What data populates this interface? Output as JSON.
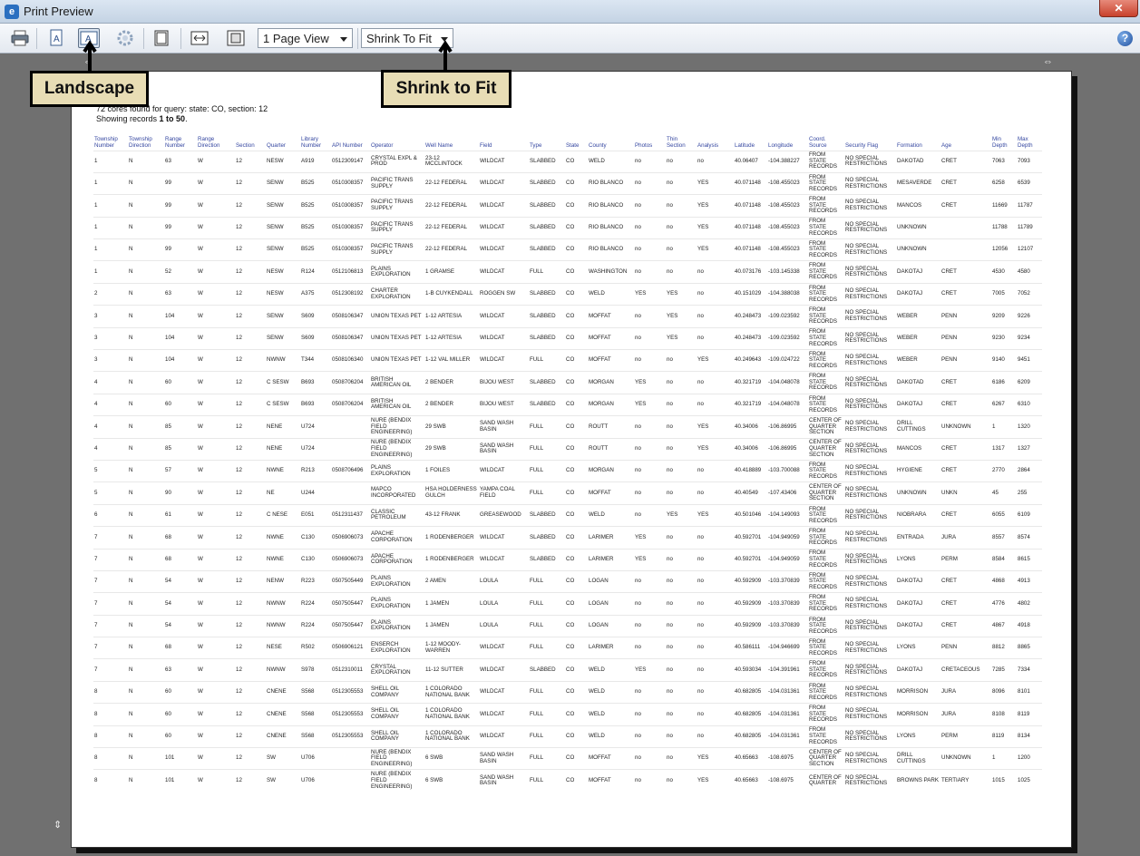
{
  "window": {
    "title": "Print Preview"
  },
  "toolbar": {
    "page_view": "1 Page View",
    "shrink": "Shrink To Fit",
    "print_icon": "printer-icon",
    "portrait_icon": "portrait-icon",
    "landscape_icon": "landscape-icon",
    "page_setup_icon": "gear-icon",
    "header_footer_icon": "header-footer-icon",
    "full_width_icon": "full-width-icon",
    "full_page_icon": "full-page-icon",
    "help_icon": "help-icon"
  },
  "callouts": {
    "landscape": "Landscape",
    "shrink": "Shrink to Fit"
  },
  "report": {
    "line1": "72 cores found for query: state: CO, section: 12",
    "line2_prefix": "Showing records ",
    "line2_range": "1 to 50",
    "line2_suffix": "."
  },
  "table": {
    "columns": [
      "Township Number",
      "Township Direction",
      "Range Number",
      "Range Direction",
      "Section",
      "Quarter",
      "Library Number",
      "API Number",
      "Operator",
      "Well Name",
      "Field",
      "Type",
      "State",
      "County",
      "Photos",
      "Thin Section",
      "Analysis",
      "Latitude",
      "Longitude",
      "Coord. Source",
      "Security Flag",
      "Formation",
      "Age",
      "Min Depth",
      "Max Depth"
    ],
    "rows": [
      [
        "1",
        "N",
        "63",
        "W",
        "12",
        "NESW",
        "A919",
        "0512309147",
        "CRYSTAL EXPL & PROD",
        "23-12 MCCLINTOCK",
        "WILDCAT",
        "SLABBED",
        "CO",
        "WELD",
        "no",
        "no",
        "no",
        "40.06407",
        "-104.388227",
        "FROM STATE RECORDS",
        "NO SPECIAL RESTRICTIONS",
        "DAKOTAD",
        "CRET",
        "7063",
        "7093"
      ],
      [
        "1",
        "N",
        "99",
        "W",
        "12",
        "SENW",
        "B525",
        "0510308357",
        "PACIFIC TRANS SUPPLY",
        "22-12 FEDERAL",
        "WILDCAT",
        "SLABBED",
        "CO",
        "RIO BLANCO",
        "no",
        "no",
        "YES",
        "40.071148",
        "-108.455023",
        "FROM STATE RECORDS",
        "NO SPECIAL RESTRICTIONS",
        "MESAVERDE",
        "CRET",
        "6258",
        "6539"
      ],
      [
        "1",
        "N",
        "99",
        "W",
        "12",
        "SENW",
        "B525",
        "0510308357",
        "PACIFIC TRANS SUPPLY",
        "22-12 FEDERAL",
        "WILDCAT",
        "SLABBED",
        "CO",
        "RIO BLANCO",
        "no",
        "no",
        "YES",
        "40.071148",
        "-108.455023",
        "FROM STATE RECORDS",
        "NO SPECIAL RESTRICTIONS",
        "MANCOS",
        "CRET",
        "11669",
        "11787"
      ],
      [
        "1",
        "N",
        "99",
        "W",
        "12",
        "SENW",
        "B525",
        "0510308357",
        "PACIFIC TRANS SUPPLY",
        "22-12 FEDERAL",
        "WILDCAT",
        "SLABBED",
        "CO",
        "RIO BLANCO",
        "no",
        "no",
        "YES",
        "40.071148",
        "-108.455023",
        "FROM STATE RECORDS",
        "NO SPECIAL RESTRICTIONS",
        "UNKNOWN",
        "",
        "11788",
        "11789"
      ],
      [
        "1",
        "N",
        "99",
        "W",
        "12",
        "SENW",
        "B525",
        "0510308357",
        "PACIFIC TRANS SUPPLY",
        "22-12 FEDERAL",
        "WILDCAT",
        "SLABBED",
        "CO",
        "RIO BLANCO",
        "no",
        "no",
        "YES",
        "40.071148",
        "-108.455023",
        "FROM STATE RECORDS",
        "NO SPECIAL RESTRICTIONS",
        "UNKNOWN",
        "",
        "12056",
        "12107"
      ],
      [
        "1",
        "N",
        "52",
        "W",
        "12",
        "NESW",
        "R124",
        "0512106813",
        "PLAINS EXPLORATION",
        "1 GRAMSE",
        "WILDCAT",
        "FULL",
        "CO",
        "WASHINGTON",
        "no",
        "no",
        "no",
        "40.073176",
        "-103.145338",
        "FROM STATE RECORDS",
        "NO SPECIAL RESTRICTIONS",
        "DAKOTAJ",
        "CRET",
        "4530",
        "4580"
      ],
      [
        "2",
        "N",
        "63",
        "W",
        "12",
        "NESW",
        "A375",
        "0512308192",
        "CHARTER EXPLORATION",
        "1-B CUYKENDALL",
        "ROGGEN SW",
        "SLABBED",
        "CO",
        "WELD",
        "YES",
        "YES",
        "no",
        "40.151029",
        "-104.388038",
        "FROM STATE RECORDS",
        "NO SPECIAL RESTRICTIONS",
        "DAKOTAJ",
        "CRET",
        "7005",
        "7052"
      ],
      [
        "3",
        "N",
        "104",
        "W",
        "12",
        "SENW",
        "S609",
        "0508106347",
        "UNION TEXAS PET",
        "1-12 ARTESIA",
        "WILDCAT",
        "SLABBED",
        "CO",
        "MOFFAT",
        "no",
        "YES",
        "no",
        "40.248473",
        "-109.023592",
        "FROM STATE RECORDS",
        "NO SPECIAL RESTRICTIONS",
        "WEBER",
        "PENN",
        "9209",
        "9226"
      ],
      [
        "3",
        "N",
        "104",
        "W",
        "12",
        "SENW",
        "S609",
        "0508106347",
        "UNION TEXAS PET",
        "1-12 ARTESIA",
        "WILDCAT",
        "SLABBED",
        "CO",
        "MOFFAT",
        "no",
        "YES",
        "no",
        "40.248473",
        "-109.023592",
        "FROM STATE RECORDS",
        "NO SPECIAL RESTRICTIONS",
        "WEBER",
        "PENN",
        "9230",
        "9234"
      ],
      [
        "3",
        "N",
        "104",
        "W",
        "12",
        "NWNW",
        "T344",
        "0508106340",
        "UNION TEXAS PET",
        "1-12 VAL MILLER",
        "WILDCAT",
        "FULL",
        "CO",
        "MOFFAT",
        "no",
        "no",
        "YES",
        "40.249643",
        "-109.024722",
        "FROM STATE RECORDS",
        "NO SPECIAL RESTRICTIONS",
        "WEBER",
        "PENN",
        "9140",
        "9451"
      ],
      [
        "4",
        "N",
        "60",
        "W",
        "12",
        "C SESW",
        "B693",
        "0508706204",
        "BRITISH AMERICAN OIL",
        "2 BENDER",
        "BIJOU WEST",
        "SLABBED",
        "CO",
        "MORGAN",
        "YES",
        "no",
        "no",
        "40.321719",
        "-104.048078",
        "FROM STATE RECORDS",
        "NO SPECIAL RESTRICTIONS",
        "DAKOTAD",
        "CRET",
        "6186",
        "6209"
      ],
      [
        "4",
        "N",
        "60",
        "W",
        "12",
        "C SESW",
        "B693",
        "0508706204",
        "BRITISH AMERICAN OIL",
        "2 BENDER",
        "BIJOU WEST",
        "SLABBED",
        "CO",
        "MORGAN",
        "YES",
        "no",
        "no",
        "40.321719",
        "-104.048078",
        "FROM STATE RECORDS",
        "NO SPECIAL RESTRICTIONS",
        "DAKOTAJ",
        "CRET",
        "6267",
        "6310"
      ],
      [
        "4",
        "N",
        "85",
        "W",
        "12",
        "NENE",
        "U724",
        "",
        "NURE (BENDIX FIELD ENGINEERING)",
        "29 SWB",
        "SAND WASH BASIN",
        "FULL",
        "CO",
        "ROUTT",
        "no",
        "no",
        "YES",
        "40.34006",
        "-106.86995",
        "CENTER OF QUARTER SECTION",
        "NO SPECIAL RESTRICTIONS",
        "DRILL CUTTINGS",
        "UNKNOWN",
        "1",
        "1320"
      ],
      [
        "4",
        "N",
        "85",
        "W",
        "12",
        "NENE",
        "U724",
        "",
        "NURE (BENDIX FIELD ENGINEERING)",
        "29 SWB",
        "SAND WASH BASIN",
        "FULL",
        "CO",
        "ROUTT",
        "no",
        "no",
        "YES",
        "40.34006",
        "-106.86995",
        "CENTER OF QUARTER SECTION",
        "NO SPECIAL RESTRICTIONS",
        "MANCOS",
        "CRET",
        "1317",
        "1327"
      ],
      [
        "5",
        "N",
        "57",
        "W",
        "12",
        "NWNE",
        "R213",
        "0508706496",
        "PLAINS EXPLORATION",
        "1 FOILES",
        "WILDCAT",
        "FULL",
        "CO",
        "MORGAN",
        "no",
        "no",
        "no",
        "40.418889",
        "-103.700088",
        "FROM STATE RECORDS",
        "NO SPECIAL RESTRICTIONS",
        "HYGIENE",
        "CRET",
        "2770",
        "2864"
      ],
      [
        "5",
        "N",
        "90",
        "W",
        "12",
        "NE",
        "U244",
        "",
        "MAPCO INCORPORATED",
        "HSA HOLDERNESS GULCH",
        "YAMPA COAL FIELD",
        "FULL",
        "CO",
        "MOFFAT",
        "no",
        "no",
        "no",
        "40.40549",
        "-107.43406",
        "CENTER OF QUARTER SECTION",
        "NO SPECIAL RESTRICTIONS",
        "UNKNOWN",
        "UNKN",
        "45",
        "255"
      ],
      [
        "6",
        "N",
        "61",
        "W",
        "12",
        "C NESE",
        "E051",
        "0512311437",
        "CLASSIC PETROLEUM",
        "43-12 FRANK",
        "GREASEWOOD",
        "SLABBED",
        "CO",
        "WELD",
        "no",
        "YES",
        "YES",
        "40.501046",
        "-104.149093",
        "FROM STATE RECORDS",
        "NO SPECIAL RESTRICTIONS",
        "NIOBRARA",
        "CRET",
        "6055",
        "6109"
      ],
      [
        "7",
        "N",
        "68",
        "W",
        "12",
        "NWNE",
        "C130",
        "0506906073",
        "APACHE CORPORATION",
        "1 RODENBERGER",
        "WILDCAT",
        "SLABBED",
        "CO",
        "LARIMER",
        "YES",
        "no",
        "no",
        "40.592701",
        "-104.949059",
        "FROM STATE RECORDS",
        "NO SPECIAL RESTRICTIONS",
        "ENTRADA",
        "JURA",
        "8557",
        "8574"
      ],
      [
        "7",
        "N",
        "68",
        "W",
        "12",
        "NWNE",
        "C130",
        "0506906073",
        "APACHE CORPORATION",
        "1 RODENBERGER",
        "WILDCAT",
        "SLABBED",
        "CO",
        "LARIMER",
        "YES",
        "no",
        "no",
        "40.592701",
        "-104.949059",
        "FROM STATE RECORDS",
        "NO SPECIAL RESTRICTIONS",
        "LYONS",
        "PERM",
        "8584",
        "8615"
      ],
      [
        "7",
        "N",
        "54",
        "W",
        "12",
        "NENW",
        "R223",
        "0507505449",
        "PLAINS EXPLORATION",
        "2 AMEN",
        "LOULA",
        "FULL",
        "CO",
        "LOGAN",
        "no",
        "no",
        "no",
        "40.592909",
        "-103.370839",
        "FROM STATE RECORDS",
        "NO SPECIAL RESTRICTIONS",
        "DAKOTAJ",
        "CRET",
        "4868",
        "4913"
      ],
      [
        "7",
        "N",
        "54",
        "W",
        "12",
        "NWNW",
        "R224",
        "0507505447",
        "PLAINS EXPLORATION",
        "1 JAMEN",
        "LOULA",
        "FULL",
        "CO",
        "LOGAN",
        "no",
        "no",
        "no",
        "40.592909",
        "-103.370839",
        "FROM STATE RECORDS",
        "NO SPECIAL RESTRICTIONS",
        "DAKOTAJ",
        "CRET",
        "4776",
        "4802"
      ],
      [
        "7",
        "N",
        "54",
        "W",
        "12",
        "NWNW",
        "R224",
        "0507505447",
        "PLAINS EXPLORATION",
        "1 JAMEN",
        "LOULA",
        "FULL",
        "CO",
        "LOGAN",
        "no",
        "no",
        "no",
        "40.592909",
        "-103.370839",
        "FROM STATE RECORDS",
        "NO SPECIAL RESTRICTIONS",
        "DAKOTAJ",
        "CRET",
        "4867",
        "4918"
      ],
      [
        "7",
        "N",
        "68",
        "W",
        "12",
        "NESE",
        "R502",
        "0506906121",
        "ENSERCH EXPLORATION",
        "1-12 MOODY-WARREN",
        "WILDCAT",
        "FULL",
        "CO",
        "LARIMER",
        "no",
        "no",
        "no",
        "40.586111",
        "-104.946699",
        "FROM STATE RECORDS",
        "NO SPECIAL RESTRICTIONS",
        "LYONS",
        "PENN",
        "8812",
        "8865"
      ],
      [
        "7",
        "N",
        "63",
        "W",
        "12",
        "NWNW",
        "S978",
        "0512310011",
        "CRYSTAL EXPLORATION",
        "11-12 SUTTER",
        "WILDCAT",
        "SLABBED",
        "CO",
        "WELD",
        "YES",
        "no",
        "no",
        "40.593034",
        "-104.391961",
        "FROM STATE RECORDS",
        "NO SPECIAL RESTRICTIONS",
        "DAKOTAJ",
        "CRETACEOUS",
        "7285",
        "7334"
      ],
      [
        "8",
        "N",
        "60",
        "W",
        "12",
        "CNENE",
        "S568",
        "0512305553",
        "SHELL OIL COMPANY",
        "1 COLORADO NATIONAL BANK",
        "WILDCAT",
        "FULL",
        "CO",
        "WELD",
        "no",
        "no",
        "no",
        "40.682805",
        "-104.031361",
        "FROM STATE RECORDS",
        "NO SPECIAL RESTRICTIONS",
        "MORRISON",
        "JURA",
        "8096",
        "8101"
      ],
      [
        "8",
        "N",
        "60",
        "W",
        "12",
        "CNENE",
        "S568",
        "0512305553",
        "SHELL OIL COMPANY",
        "1 COLORADO NATIONAL BANK",
        "WILDCAT",
        "FULL",
        "CO",
        "WELD",
        "no",
        "no",
        "no",
        "40.682805",
        "-104.031361",
        "FROM STATE RECORDS",
        "NO SPECIAL RESTRICTIONS",
        "MORRISON",
        "JURA",
        "8108",
        "8119"
      ],
      [
        "8",
        "N",
        "60",
        "W",
        "12",
        "CNENE",
        "S568",
        "0512305553",
        "SHELL OIL COMPANY",
        "1 COLORADO NATIONAL BANK",
        "WILDCAT",
        "FULL",
        "CO",
        "WELD",
        "no",
        "no",
        "no",
        "40.682805",
        "-104.031361",
        "FROM STATE RECORDS",
        "NO SPECIAL RESTRICTIONS",
        "LYONS",
        "PERM",
        "8119",
        "8134"
      ],
      [
        "8",
        "N",
        "101",
        "W",
        "12",
        "SW",
        "U706",
        "",
        "NURE (BENDIX FIELD ENGINEERING)",
        "6 SWB",
        "SAND WASH BASIN",
        "FULL",
        "CO",
        "MOFFAT",
        "no",
        "no",
        "YES",
        "40.65663",
        "-108.6975",
        "CENTER OF QUARTER SECTION",
        "NO SPECIAL RESTRICTIONS",
        "DRILL CUTTINGS",
        "UNKNOWN",
        "1",
        "1200"
      ],
      [
        "8",
        "N",
        "101",
        "W",
        "12",
        "SW",
        "U706",
        "",
        "NURE (BENDIX FIELD ENGINEERING)",
        "6 SWB",
        "SAND WASH BASIN",
        "FULL",
        "CO",
        "MOFFAT",
        "no",
        "no",
        "YES",
        "40.65663",
        "-108.6975",
        "CENTER OF QUARTER",
        "NO SPECIAL RESTRICTIONS",
        "BROWNS PARK",
        "TERTIARY",
        "1015",
        "1025"
      ]
    ]
  }
}
